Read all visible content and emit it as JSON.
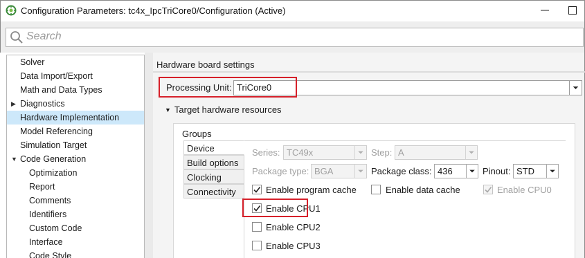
{
  "window": {
    "title": "Configuration Parameters: tc4x_IpcTriCore0/Configuration (Active)",
    "controls": [
      "minimize-icon",
      "maximize-icon"
    ]
  },
  "search": {
    "placeholder": "Search",
    "icon": "search-icon"
  },
  "nav": {
    "items": [
      {
        "label": "Solver",
        "indent": 0,
        "arrow": "",
        "selected": false
      },
      {
        "label": "Data Import/Export",
        "indent": 0,
        "arrow": "",
        "selected": false
      },
      {
        "label": "Math and Data Types",
        "indent": 0,
        "arrow": "",
        "selected": false
      },
      {
        "label": "Diagnostics",
        "indent": 0,
        "arrow": "▶",
        "selected": false
      },
      {
        "label": "Hardware Implementation",
        "indent": 0,
        "arrow": "",
        "selected": true
      },
      {
        "label": "Model Referencing",
        "indent": 0,
        "arrow": "",
        "selected": false
      },
      {
        "label": "Simulation Target",
        "indent": 0,
        "arrow": "",
        "selected": false
      },
      {
        "label": "Code Generation",
        "indent": 0,
        "arrow": "▼",
        "selected": false
      },
      {
        "label": "Optimization",
        "indent": 1,
        "arrow": "",
        "selected": false
      },
      {
        "label": "Report",
        "indent": 1,
        "arrow": "",
        "selected": false
      },
      {
        "label": "Comments",
        "indent": 1,
        "arrow": "",
        "selected": false
      },
      {
        "label": "Identifiers",
        "indent": 1,
        "arrow": "",
        "selected": false
      },
      {
        "label": "Custom Code",
        "indent": 1,
        "arrow": "",
        "selected": false
      },
      {
        "label": "Interface",
        "indent": 1,
        "arrow": "",
        "selected": false
      },
      {
        "label": "Code Style",
        "indent": 1,
        "arrow": "",
        "selected": false
      }
    ]
  },
  "hardware": {
    "heading": "Hardware board settings",
    "processing_unit_label": "Processing Unit:",
    "processing_unit_value": "TriCore0",
    "target_section_label": "Target hardware resources",
    "target_section_arrow": "▼",
    "groups_label": "Groups",
    "tabs": [
      "Device",
      "Build options",
      "Clocking",
      "Connectivity"
    ],
    "active_tab": "Device",
    "series_label": "Series:",
    "series_value": "TC49x",
    "step_label": "Step:",
    "step_value": "A",
    "package_type_label": "Package type:",
    "package_type_value": "BGA",
    "package_class_label": "Package class:",
    "package_class_value": "436",
    "pinout_label": "Pinout:",
    "pinout_value": "STD",
    "checkboxes": {
      "program_cache": {
        "label": "Enable program cache",
        "checked": true,
        "disabled": false
      },
      "data_cache": {
        "label": "Enable data cache",
        "checked": false,
        "disabled": false
      },
      "cpu0": {
        "label": "Enable CPU0",
        "checked": true,
        "disabled": true
      },
      "cpu1": {
        "label": "Enable CPU1",
        "checked": true,
        "disabled": false
      },
      "cpu2": {
        "label": "Enable CPU2",
        "checked": false,
        "disabled": false
      },
      "cpu3": {
        "label": "Enable CPU3",
        "checked": false,
        "disabled": false
      }
    }
  },
  "colors": {
    "highlight_red": "#d6202a",
    "selection_blue": "#cde8fa",
    "disabled_text": "#a0a0a0"
  }
}
